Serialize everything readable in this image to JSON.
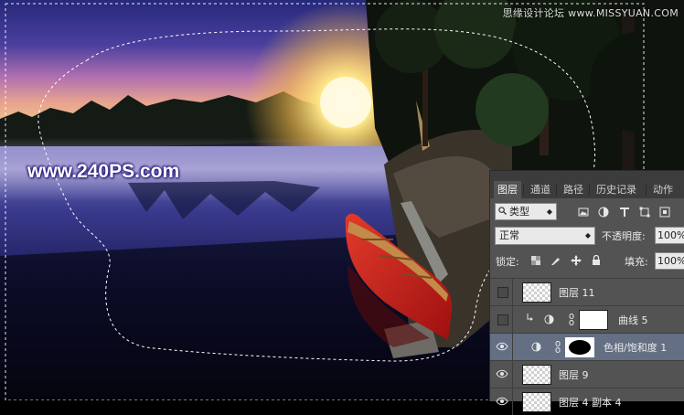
{
  "watermark": {
    "top_text": "思缘设计论坛 www.MISSYUAN.COM",
    "site_text": "www.240PS.com"
  },
  "layers_panel": {
    "tabs": [
      {
        "label": "图层",
        "active": true
      },
      {
        "label": "通道",
        "active": false
      },
      {
        "label": "路径",
        "active": false
      },
      {
        "label": "历史记录",
        "active": false
      },
      {
        "label": "动作",
        "active": false
      }
    ],
    "filter": {
      "value": "类型",
      "icon": "search-icon"
    },
    "filter_icons": [
      "image-filter-icon",
      "adjustment-filter-icon",
      "text-filter-icon",
      "shape-filter-icon",
      "smart-object-filter-icon"
    ],
    "blend_mode": "正常",
    "opacity_label": "不透明度:",
    "opacity_value": "100%",
    "lock_label": "锁定:",
    "lock_icons": [
      "lock-transparency-icon",
      "lock-pixels-icon",
      "lock-position-icon",
      "lock-all-icon"
    ],
    "fill_label": "填充:",
    "fill_value": "100%",
    "layers": [
      {
        "name": "图层 11",
        "visible": false,
        "type": "pixel",
        "selected": false
      },
      {
        "name": "曲线 5",
        "visible": false,
        "type": "curves-adjustment",
        "selected": false,
        "clipped": true
      },
      {
        "name": "色相/饱和度 1",
        "visible": true,
        "type": "hue-saturation-adjustment",
        "selected": true
      },
      {
        "name": "图层 9",
        "visible": true,
        "type": "pixel",
        "selected": false
      },
      {
        "name": "图层 4 副本 4",
        "visible": true,
        "type": "pixel",
        "selected": false
      }
    ]
  },
  "colors": {
    "panel_bg": "#535353",
    "panel_tab_bg": "#3c3c3c",
    "selected_row": "#646f84",
    "canoe": "#c41e1e"
  }
}
